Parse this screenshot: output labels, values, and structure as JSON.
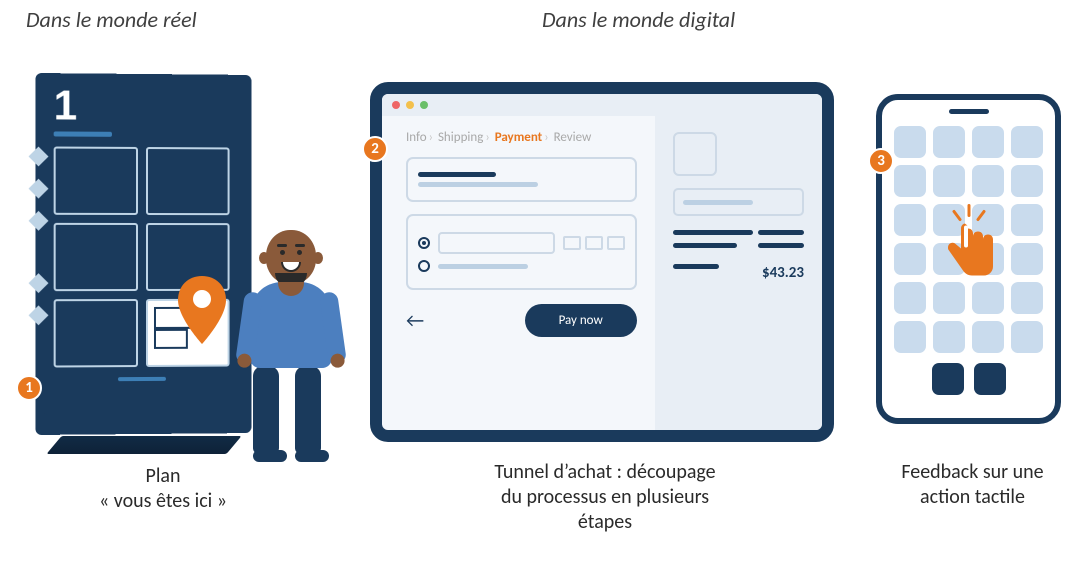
{
  "headings": {
    "real": "Dans le monde réel",
    "digital": "Dans le monde digital"
  },
  "badges": {
    "one": "1",
    "two": "2",
    "three": "3"
  },
  "kiosk": {
    "number": "1"
  },
  "checkout": {
    "breadcrumb": {
      "info": "Info",
      "shipping": "Shipping",
      "payment": "Payment",
      "review": "Review"
    },
    "button": "Pay now",
    "total": "$43.23"
  },
  "captions": {
    "c1a": "Plan",
    "c1b": "« vous êtes ici »",
    "c2a": "Tunnel d’achat : découpage",
    "c2b": "du processus en plusieurs",
    "c2c": "étapes",
    "c3a": "Feedback sur une",
    "c3b": "action tactile"
  }
}
